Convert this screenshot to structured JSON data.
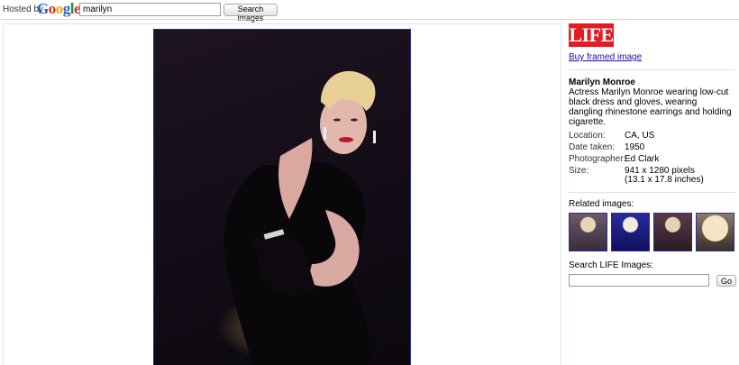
{
  "header": {
    "hosted_by": "Hosted by",
    "logo_letters": [
      "G",
      "o",
      "o",
      "g",
      "l",
      "e"
    ],
    "logo_tm": "™",
    "search_value": "marilyn",
    "search_button": "Search images"
  },
  "photo": {
    "subject": "Marilyn Monroe portrait"
  },
  "sidebar": {
    "brand": "LIFE",
    "buy_link": "Buy framed image",
    "title": "Marilyn Monroe",
    "description": "Actress Marilyn Monroe wearing low-cut black dress and gloves, wearing dangling rhinestone earrings and holding cigarette.",
    "meta": [
      {
        "label": "Location:",
        "value": "CA, US"
      },
      {
        "label": "Date taken:",
        "value": "1950"
      },
      {
        "label": "Photographer:",
        "value": "Ed Clark"
      },
      {
        "label": "Size:",
        "value": "941 x 1280 pixels",
        "value2": "(13.1 x 17.8 inches)"
      }
    ],
    "related_label": "Related images:",
    "search_life_label": "Search LIFE Images:",
    "search_life_value": "",
    "go_button": "Go"
  },
  "colors": {
    "life_red": "#e31b23",
    "link_blue": "#1a0dab",
    "thumb_border": "#2b2b9a"
  }
}
